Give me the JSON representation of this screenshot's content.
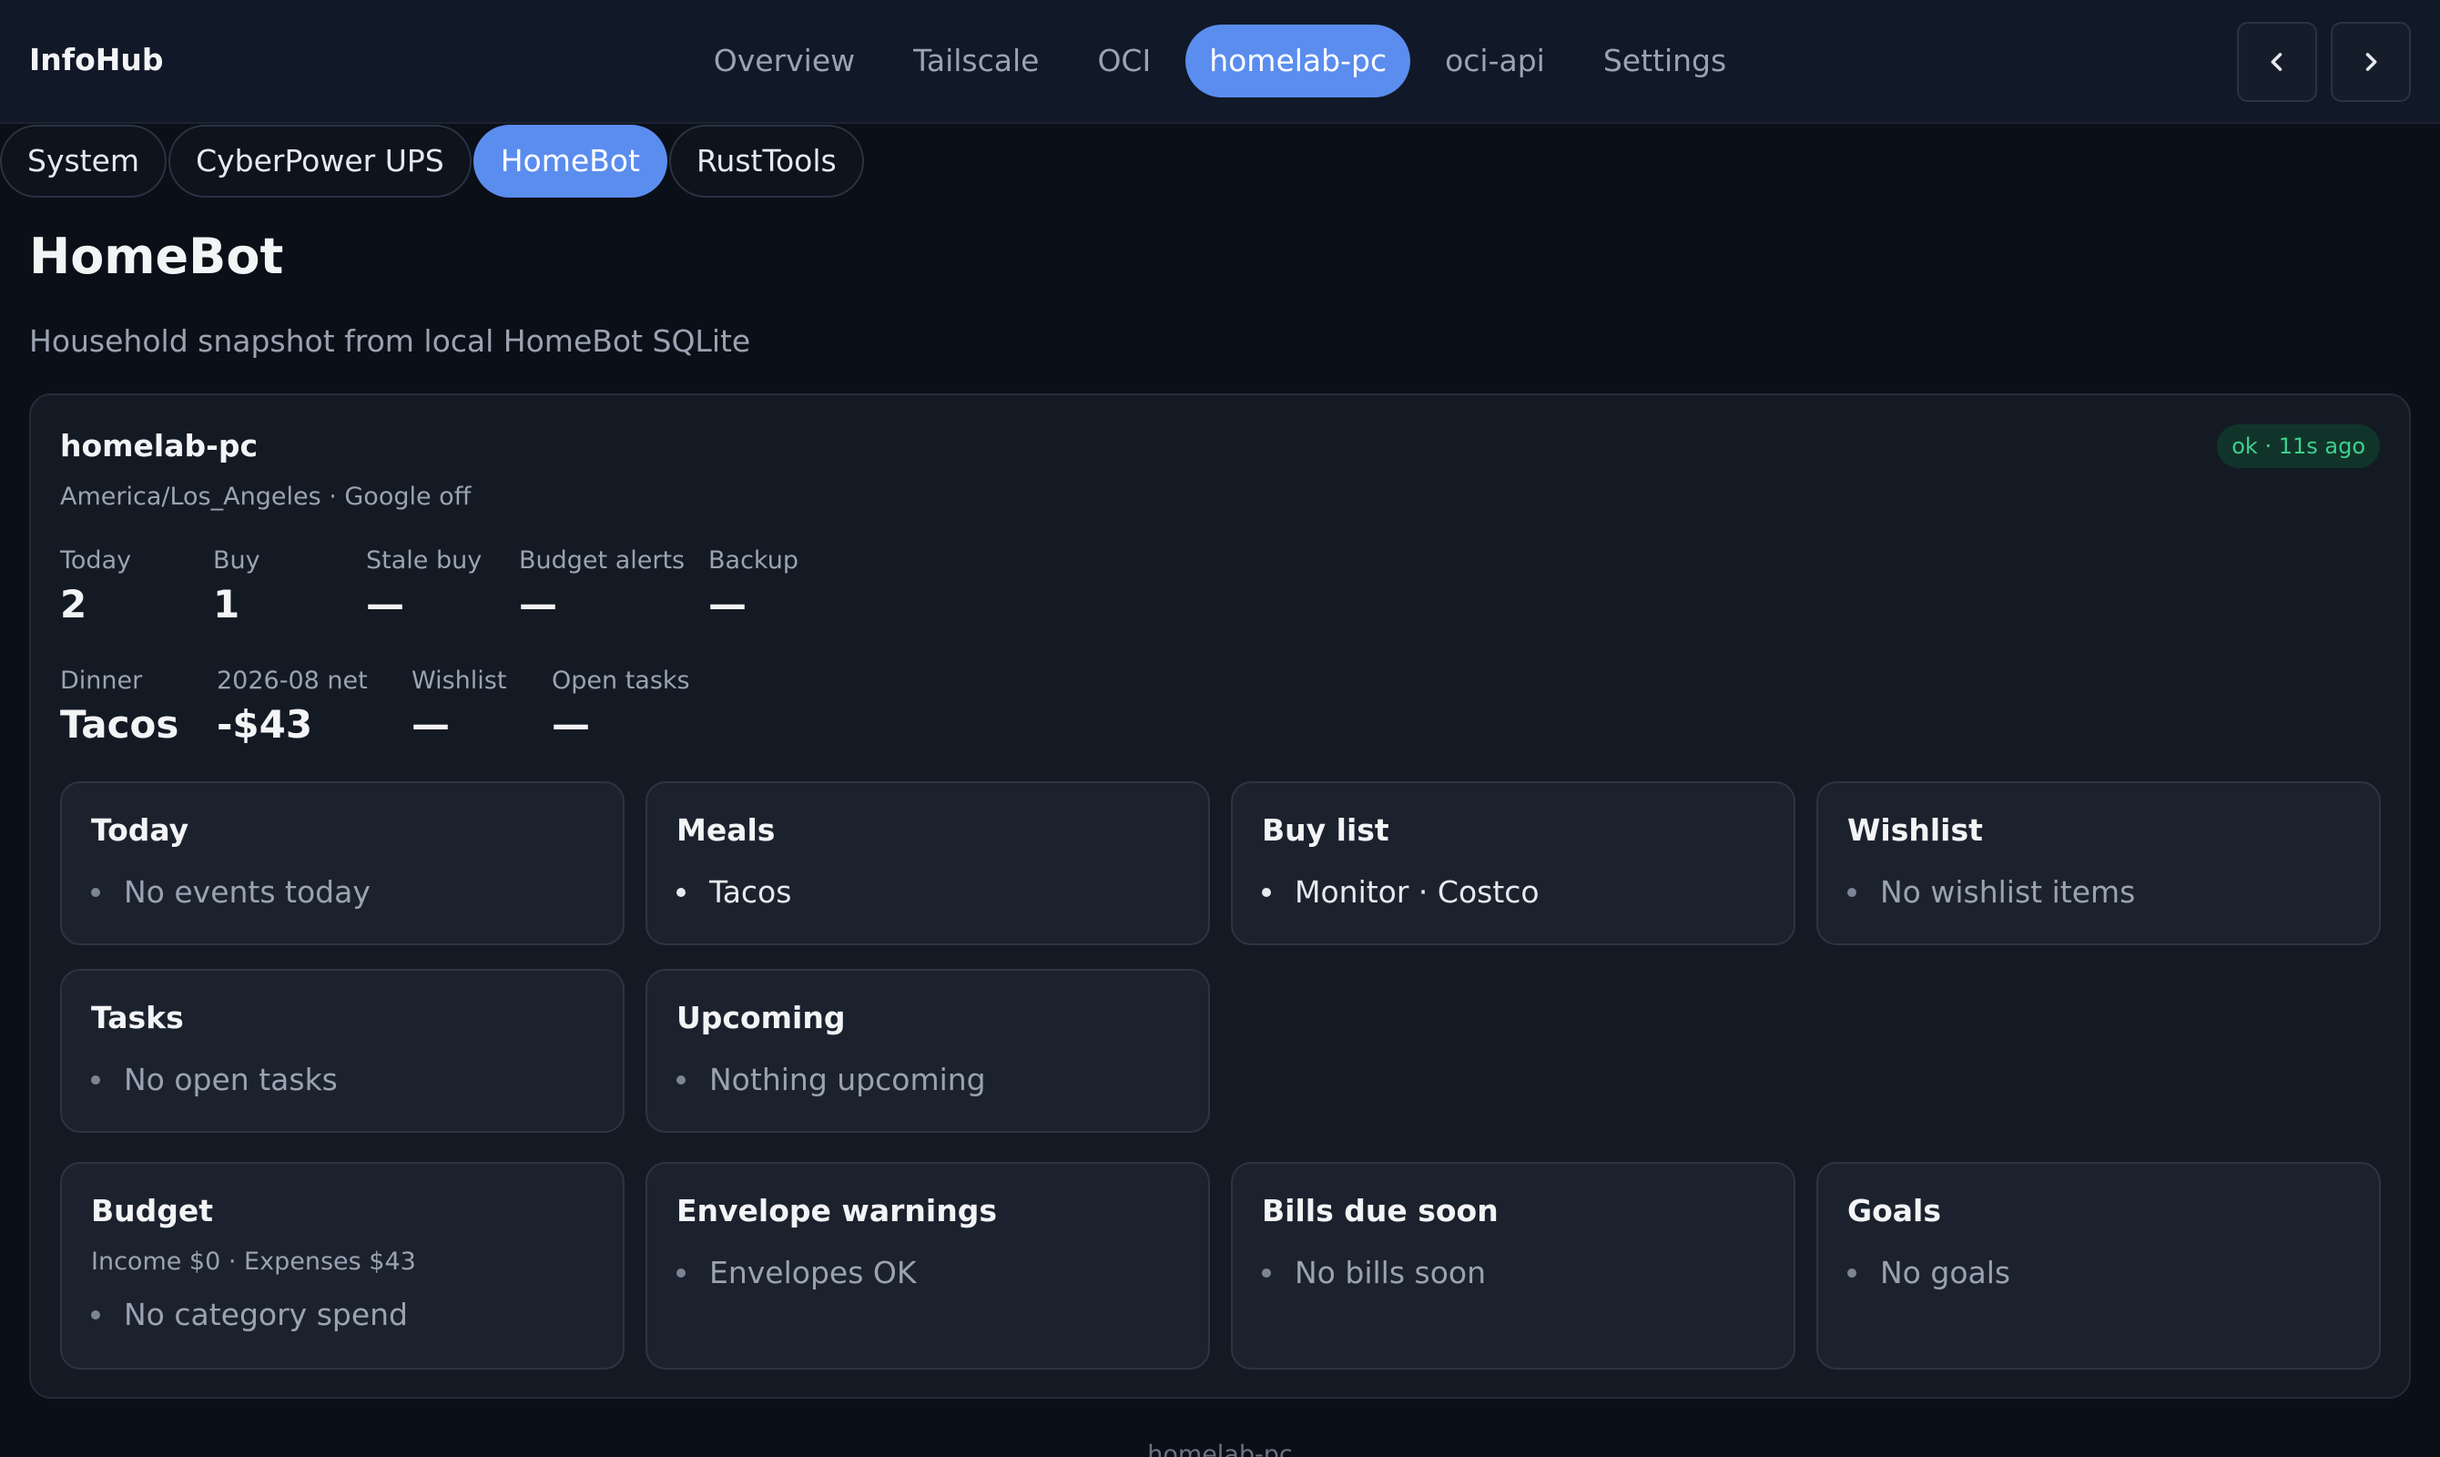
{
  "app": {
    "brand": "InfoHub"
  },
  "nav": {
    "items": [
      "Overview",
      "Tailscale",
      "OCI",
      "homelab-pc",
      "oci-api",
      "Settings"
    ],
    "active_index": 3
  },
  "subtabs": {
    "items": [
      "System",
      "CyberPower UPS",
      "HomeBot",
      "RustTools"
    ],
    "active_index": 2
  },
  "page": {
    "title": "HomeBot",
    "subtitle": "Household snapshot from local HomeBot SQLite"
  },
  "host": {
    "name": "homelab-pc",
    "meta": "America/Los_Angeles · Google off",
    "status": "ok · 11s ago",
    "status_color": "#3fcf8e"
  },
  "stats_row1": [
    {
      "label": "Today",
      "value": "2"
    },
    {
      "label": "Buy",
      "value": "1"
    },
    {
      "label": "Stale buy",
      "value": "—"
    },
    {
      "label": "Budget alerts",
      "value": "—"
    },
    {
      "label": "Backup",
      "value": "—"
    }
  ],
  "stats_row2": [
    {
      "label": "Dinner",
      "value": "Tacos"
    },
    {
      "label": "2026-08 net",
      "value": "-$43"
    },
    {
      "label": "Wishlist",
      "value": "—"
    },
    {
      "label": "Open tasks",
      "value": "—"
    }
  ],
  "cards": {
    "today": {
      "title": "Today",
      "item": "No events today"
    },
    "meals": {
      "title": "Meals",
      "item": "Tacos"
    },
    "buy_list": {
      "title": "Buy list",
      "item": "Monitor · Costco"
    },
    "wishlist": {
      "title": "Wishlist",
      "item": "No wishlist items"
    },
    "tasks": {
      "title": "Tasks",
      "item": "No open tasks"
    },
    "upcoming": {
      "title": "Upcoming",
      "item": "Nothing upcoming"
    },
    "budget": {
      "title": "Budget",
      "sub": "Income $0 · Expenses $43",
      "item": "No category spend"
    },
    "envelope": {
      "title": "Envelope warnings",
      "item": "Envelopes OK"
    },
    "bills": {
      "title": "Bills due soon",
      "item": "No bills soon"
    },
    "goals": {
      "title": "Goals",
      "item": "No goals"
    }
  },
  "footer": {
    "text": "homelab-pc"
  },
  "colors": {
    "accent": "#5b8def",
    "background": "#0b0f17",
    "card": "#1c222d"
  }
}
